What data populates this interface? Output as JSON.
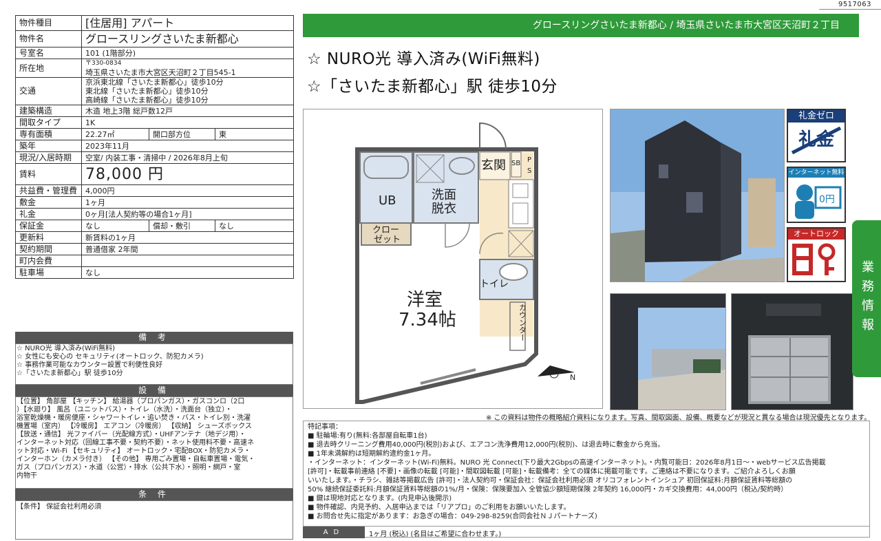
{
  "doc_id": "9517063",
  "table": [
    {
      "label": "物件種目",
      "value": "[住居用] アパート",
      "style": "big"
    },
    {
      "label": "物件名",
      "value": "グロースリングさいたま新都心",
      "style": "big"
    },
    {
      "label": "号室名",
      "value": "101 (1階部分)"
    },
    {
      "label": "所在地",
      "value": "〒330-0834",
      "value2": "埼玉県さいたま市大宮区天沼町２丁目545-1"
    },
    {
      "label": "交通",
      "value": "京浜東北線「さいたま新都心」徒歩10分",
      "value2": "東北線「さいたま新都心」徒歩10分",
      "value3": "高崎線「さいたま新都心」徒歩10分"
    },
    {
      "label": "建築構造",
      "value": "木造 地上3階 総戸数12戸"
    },
    {
      "label": "間取タイプ",
      "value": "1K"
    },
    {
      "label": "専有面積",
      "value": "22.27㎡",
      "sublabel": "開口部方位",
      "subvalue": "東"
    },
    {
      "label": "築年",
      "value": "2023年11月"
    },
    {
      "label": "現況/入居時期",
      "value": "空室/ 内装工事・清掃中 / 2026年8月上旬"
    },
    {
      "label": "賃料",
      "value": "78,000 円",
      "style": "rent"
    },
    {
      "label": "共益費・管理費",
      "value": "4,000円"
    },
    {
      "label": "敷金",
      "value": "1ヶ月"
    },
    {
      "label": "礼金",
      "value": "0ヶ月[法人契約等の場合1ヶ月]"
    },
    {
      "label": "保証金",
      "value": "なし",
      "sublabel": "償却・敷引",
      "subvalue": "なし"
    },
    {
      "label": "更新料",
      "value": "新賃料の1ヶ月"
    },
    {
      "label": "契約期間",
      "value": "普通借家 2年間"
    },
    {
      "label": "町内会費",
      "value": ""
    },
    {
      "label": "駐車場",
      "value": "なし"
    }
  ],
  "remarks": {
    "title": "備 考",
    "lines": [
      "☆ NURO光 導入済み(WiFi無料)",
      "☆ 女性にも安心の セキュリティ(オートロック、防犯カメラ)",
      "☆ 事務作業可能なカウンター設置で利便性良好",
      "☆「さいたま新都心」駅 徒歩10分"
    ]
  },
  "equipment": {
    "title": "設 備",
    "lines": [
      "【位置】 角部屋 【キッチン】 給湯器（プロパンガス）・ガスコンロ（2口",
      "）【水廻り】 風呂（ユニットバス）・トイレ（水洗）・洗面台（独立）・",
      "浴室乾燥機・暖房便座・シャワートイレ・追い焚き・バス・トイレ別・洗濯",
      "機置場（室内） 【冷暖房】 エアコン（冷暖房） 【収納】 シューズボックス",
      "【放送・通信】 光ファイバー（光配線方式）・UHFアンテナ（地デジ用）・",
      "インターネット対応（回線工事不要・契約不要）・ネット使用料不要・高速ネ",
      "ット対応・Wi-Fi 【セキュリティ】 オートロック・宅配BOX・防犯カメラ・",
      "インターホン（カメラ付き） 【その他】 専用ごみ置場・自転車置場・電気・",
      "ガス（プロパンガス）・水道（公営）・排水（公共下水）・照明・網戸・室",
      "内物干"
    ]
  },
  "conditions": {
    "title": "条 件",
    "text": "【条件】 保証会社利用必須"
  },
  "banner": "グロースリングさいたま新都心 / 埼玉県さいたま市大宮区天沼町２丁目",
  "catch1": "☆ NURO光 導入済み(WiFi無料)",
  "catch2": "☆「さいたま新都心」駅 徒歩10分",
  "plan": {
    "entrance": "玄関",
    "sb": "SB",
    "ps1": "P",
    "ps2": "S",
    "ub": "UB",
    "wash1": "洗面",
    "wash2": "脱衣",
    "closet1": "クロー",
    "closet2": "ゼット",
    "room1": "洋室",
    "room2": "7.34帖",
    "toilet": "トイレ",
    "counter": "カウンター",
    "north": "N"
  },
  "badges": {
    "reikin_title": "礼金ゼロ",
    "reikin_crossed": "礼金",
    "internet_title": "インターネット無料",
    "internet_yen": "0円",
    "autolock_title": "オートロック"
  },
  "side_tab": "業務情報",
  "disclaimer": "※ この資料は物件の概略紹介資料になります。写真、間取図面、設備、概要などが現況と異なる場合は現況優先となります。",
  "notes": [
    "特記事項：",
    "■ 駐輪場:有り(無料:各部屋自転車1台)",
    "■ 退去時クリーニング費用40,000円(税別)および、エアコン洗浄費用12,000円(税別)、は退去時に敷金から充当。",
    "■ 1年未満解約は短期解約違約金1ヶ月。",
    "・インターネット：インターネット(Wi-Fi)無料。NURO 光 Connect(下り最大2Gbpsの高速インターネット)。・内覧可能日：2026年8月1日～・webサービス広告掲載",
    "[許可]・転載事前連絡 [不要]・画像の転載 [可能]・間取図転載 [可能]・転載備考：全ての媒体に掲載可能です。ご連絡は不要になります。ご紹介よろしくお願",
    "いいたします。・チラシ、雑誌等掲載広告 [許可]・法人契約可・保証会社：保証会社利用必須 オリコフォレントインシュア 初回保証料:月額保証賃料等総額の",
    "50% 継続保証委託料:月額保証賃料等総額の1%/月・保険：保険要加入 全管協少額短期保険 2年契約 16,000円・カギ交換費用：44,000円（税込/契約時）",
    "■ 鍵は現地対応となります。(内見申込後開示)",
    "■ 物件確認、内見予約、入居申込までは「リアプロ」のご利用をお願いいたします。",
    "■ お問合せ先に指定があります：お急ぎの場合：049-298-8259(合同会社ＮＪパートナーズ)"
  ],
  "ad": {
    "label": "AD",
    "text": "1ヶ月 (税込) (名目はご希望に合わせます。)"
  }
}
